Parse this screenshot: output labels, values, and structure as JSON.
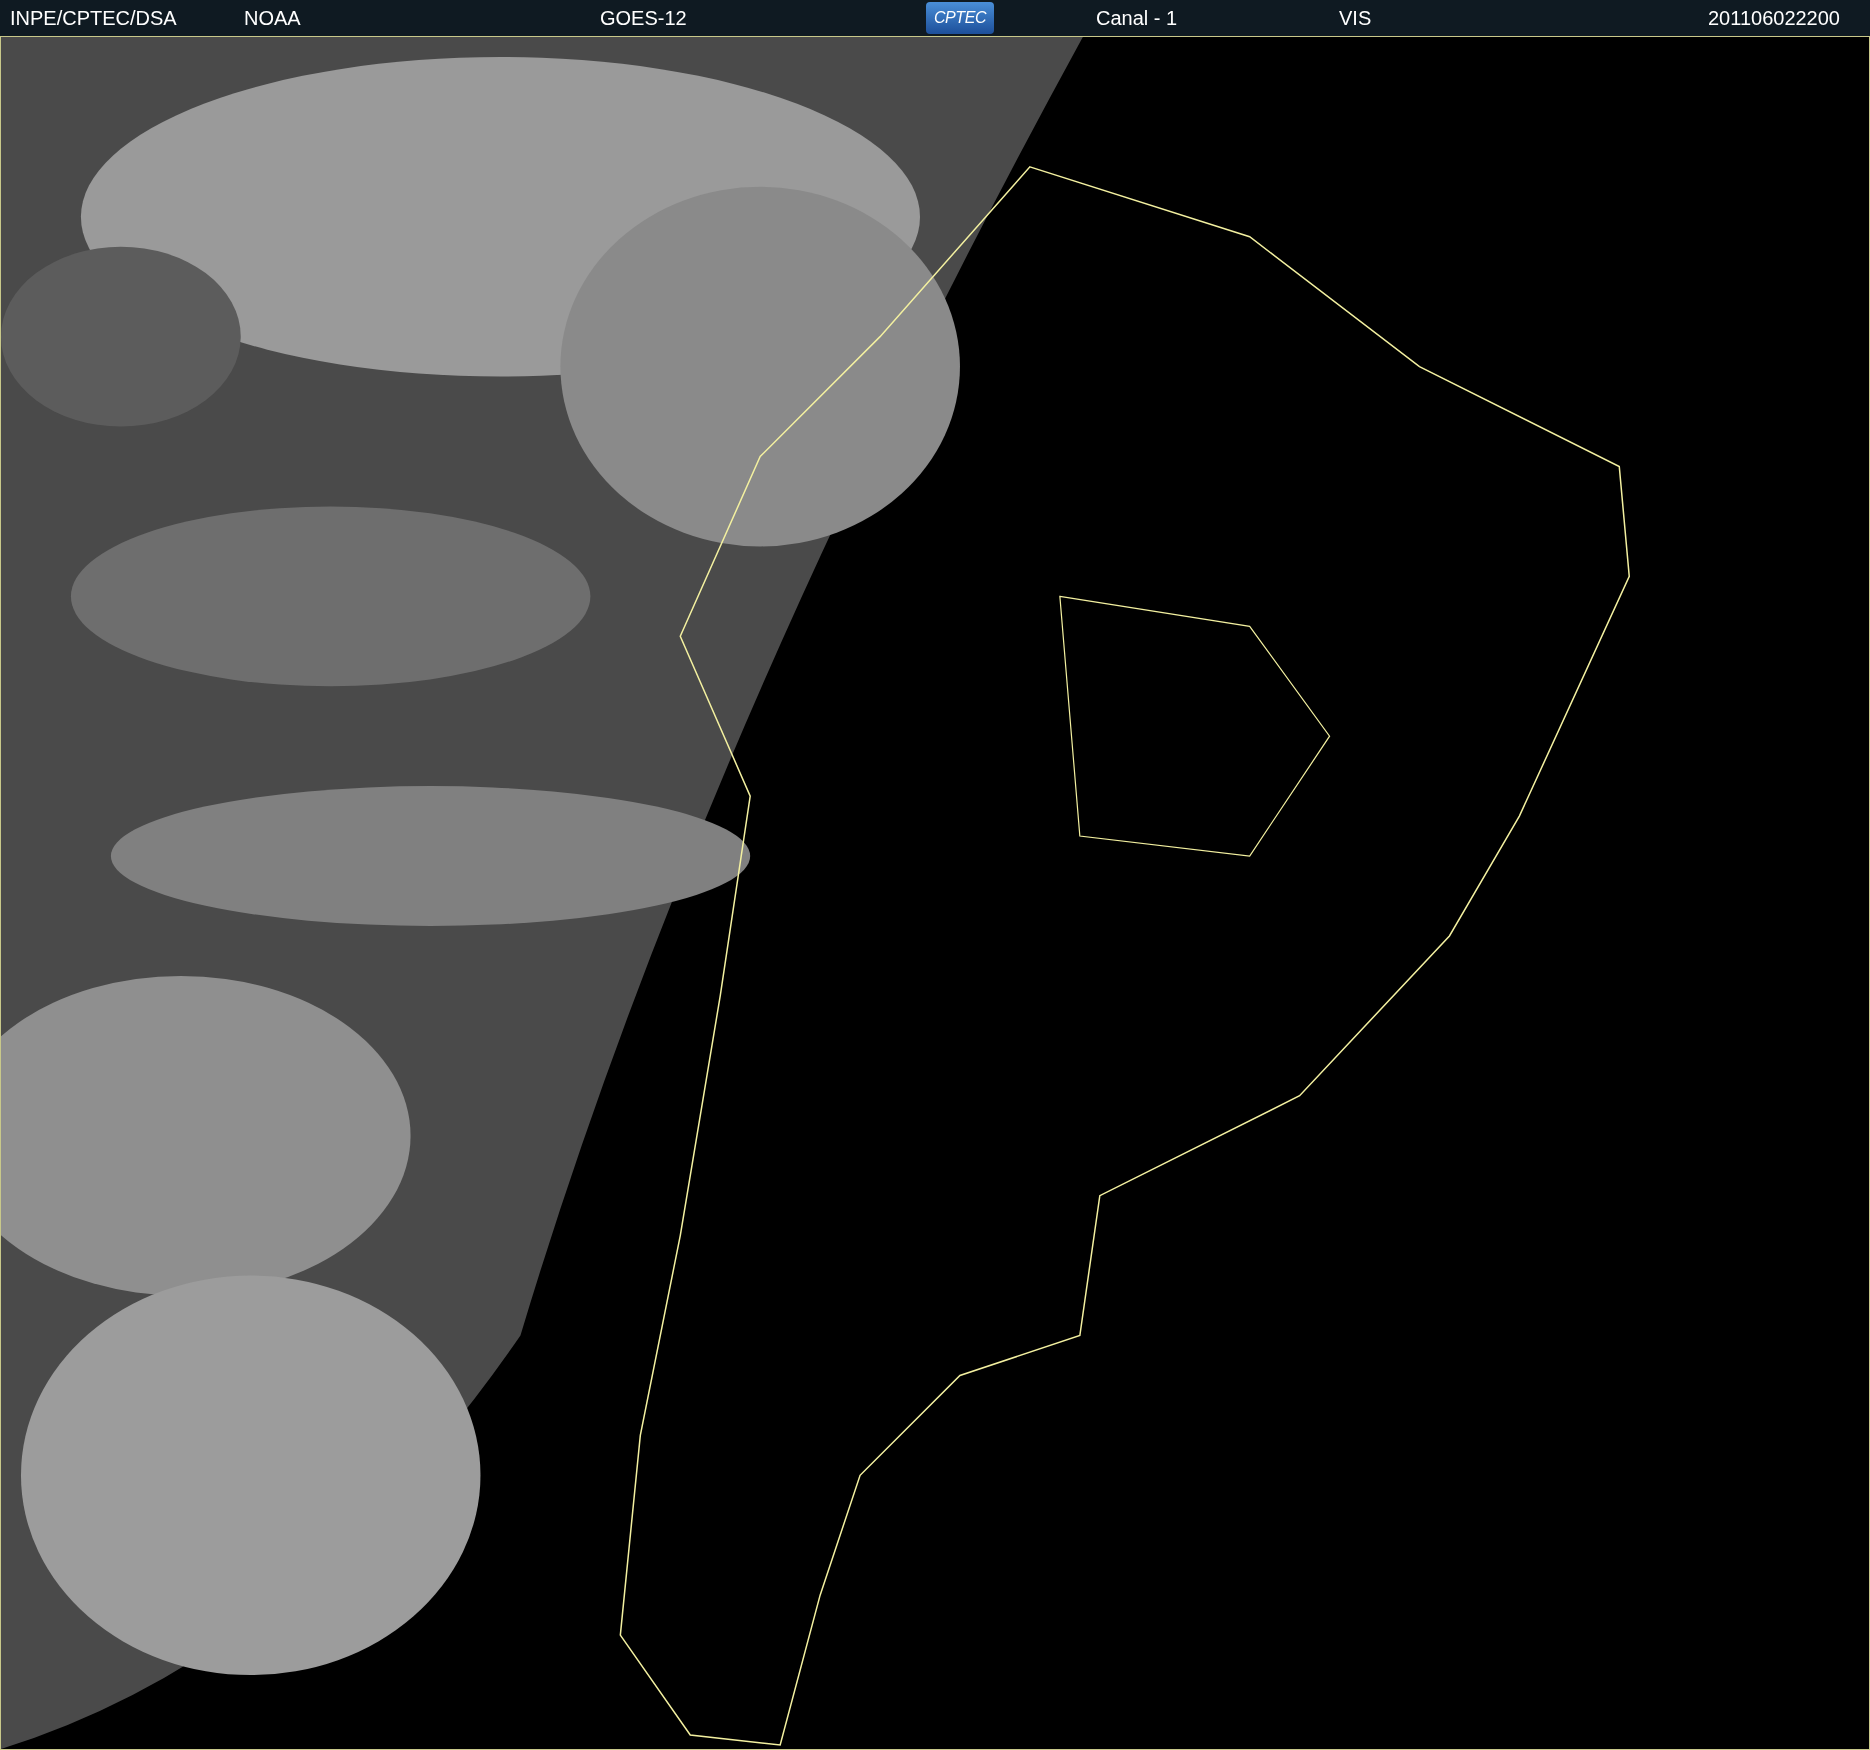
{
  "header": {
    "source": "INPE/CPTEC/DSA",
    "agency": "NOAA",
    "satellite": "GOES-12",
    "logo": "CPTEC",
    "channel": "Canal - 1",
    "band": "VIS",
    "timestamp": "201106022200"
  }
}
